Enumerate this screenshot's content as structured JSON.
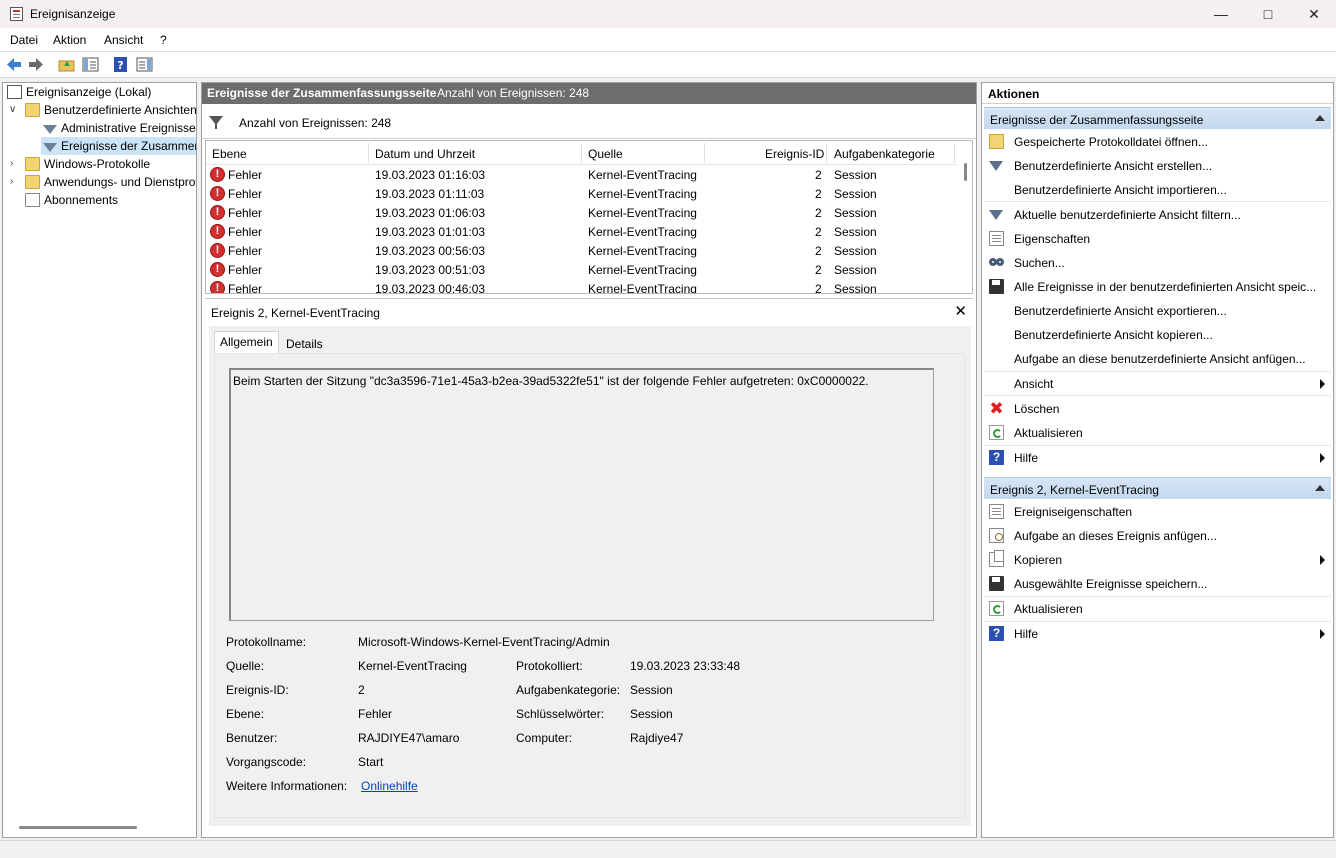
{
  "window": {
    "title": "Ereignisanzeige"
  },
  "menu": [
    "Datei",
    "Aktion",
    "Ansicht",
    "?"
  ],
  "tree": {
    "root": "Ereignisanzeige (Lokal)",
    "custom_views": "Benutzerdefinierte Ansichten",
    "admin_events": "Administrative Ereignisse",
    "summary_events": "Ereignisse der Zusammenfassungsseite",
    "windows_logs": "Windows-Protokolle",
    "app_service_logs": "Anwendungs- und Dienstprotokolle",
    "subscriptions": "Abonnements"
  },
  "center": {
    "header_title": "Ereignisse der Zusammenfassungsseite",
    "header_count": "Anzahl von Ereignissen: 248",
    "filter_text": "Anzahl von Ereignissen: 248",
    "columns": [
      "Ebene",
      "Datum und Uhrzeit",
      "Quelle",
      "Ereignis-ID",
      "Aufgabenkategorie"
    ],
    "rows": [
      [
        "Fehler",
        "19.03.2023 01:16:03",
        "Kernel-EventTracing",
        "2",
        "Session"
      ],
      [
        "Fehler",
        "19.03.2023 01:11:03",
        "Kernel-EventTracing",
        "2",
        "Session"
      ],
      [
        "Fehler",
        "19.03.2023 01:06:03",
        "Kernel-EventTracing",
        "2",
        "Session"
      ],
      [
        "Fehler",
        "19.03.2023 01:01:03",
        "Kernel-EventTracing",
        "2",
        "Session"
      ],
      [
        "Fehler",
        "19.03.2023 00:56:03",
        "Kernel-EventTracing",
        "2",
        "Session"
      ],
      [
        "Fehler",
        "19.03.2023 00:51:03",
        "Kernel-EventTracing",
        "2",
        "Session"
      ],
      [
        "Fehler",
        "19.03.2023 00:46:03",
        "Kernel-EventTracing",
        "2",
        "Session"
      ]
    ]
  },
  "detail": {
    "title": "Ereignis 2, Kernel-EventTracing",
    "tabs": [
      "Allgemein",
      "Details"
    ],
    "message": "Beim Starten der Sitzung \"dc3a3596-71e1-45a3-b2ea-39ad5322fe51\" ist der folgende Fehler aufgetreten: 0xC0000022.",
    "labels": {
      "log_name": "Protokollname:",
      "source": "Quelle:",
      "logged": "Protokolliert:",
      "event_id": "Ereignis-ID:",
      "task_category": "Aufgabenkategorie:",
      "level": "Ebene:",
      "keywords": "Schlüsselwörter:",
      "user": "Benutzer:",
      "computer": "Computer:",
      "opcode": "Vorgangscode:",
      "more_info": "Weitere Informationen:"
    },
    "values": {
      "log_name": "Microsoft-Windows-Kernel-EventTracing/Admin",
      "source": "Kernel-EventTracing",
      "logged": "19.03.2023 23:33:48",
      "event_id": "2",
      "task_category": "Session",
      "level": "Fehler",
      "keywords": "Session",
      "user": "RAJDIYE47\\amaro",
      "computer": "Rajdiye47",
      "opcode": "Start",
      "more_info": "Onlinehilfe"
    }
  },
  "actions": {
    "title": "Aktionen",
    "section1": "Ereignisse der Zusammenfassungsseite",
    "items1": [
      "Gespeicherte Protokolldatei öffnen...",
      "Benutzerdefinierte Ansicht erstellen...",
      "Benutzerdefinierte Ansicht importieren...",
      "Aktuelle benutzerdefinierte Ansicht filtern...",
      "Eigenschaften",
      "Suchen...",
      "Alle Ereignisse in der benutzerdefinierten Ansicht speic...",
      "Benutzerdefinierte Ansicht exportieren...",
      "Benutzerdefinierte Ansicht kopieren...",
      "Aufgabe an diese benutzerdefinierte Ansicht anfügen...",
      "Ansicht",
      "Löschen",
      "Aktualisieren",
      "Hilfe"
    ],
    "section2": "Ereignis 2, Kernel-EventTracing",
    "items2": [
      "Ereigniseigenschaften",
      "Aufgabe an dieses Ereignis anfügen...",
      "Kopieren",
      "Ausgewählte Ereignisse speichern...",
      "Aktualisieren",
      "Hilfe"
    ]
  },
  "colors": {
    "error": "#d32f2f",
    "section_bg": "#c9dcf1",
    "selection": "#cce4f7",
    "header_bg": "#6d6d6d"
  }
}
